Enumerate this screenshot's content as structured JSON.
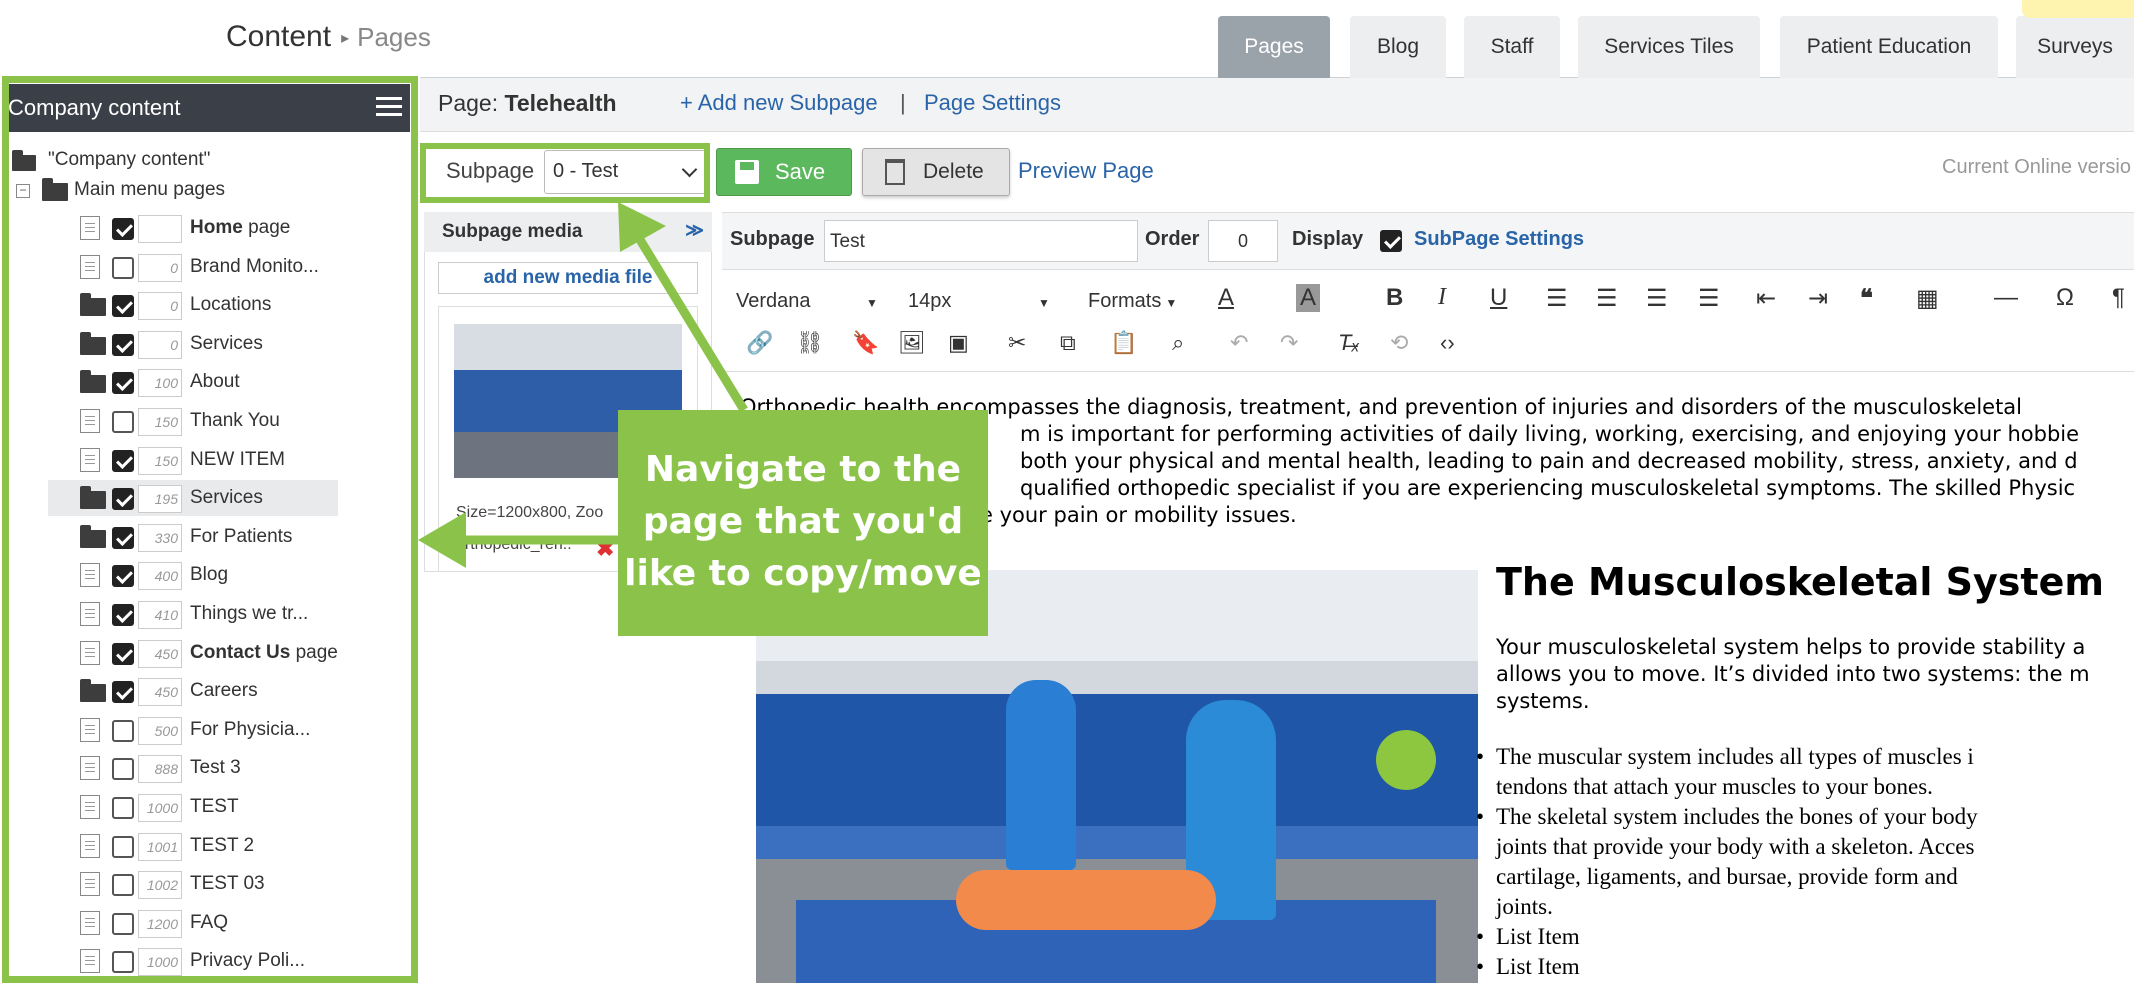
{
  "header": {
    "breadcrumb_main": "Content",
    "breadcrumb_sep": "▸",
    "breadcrumb_sub": "Pages",
    "tabs": [
      {
        "label": "Pages",
        "active": true
      },
      {
        "label": "Blog",
        "active": false
      },
      {
        "label": "Staff",
        "active": false
      },
      {
        "label": "Services Tiles",
        "active": false
      },
      {
        "label": "Patient Education",
        "active": false
      },
      {
        "label": "Surveys",
        "active": false
      }
    ]
  },
  "sidebar": {
    "title": "Company content",
    "root_label": "\"Company content\"",
    "group_label": "Main menu pages",
    "items": [
      {
        "order": "",
        "bold": "Home",
        "label": " page",
        "checked": true,
        "icon": "doc"
      },
      {
        "order": "0",
        "bold": "",
        "label": "Brand Monito...",
        "checked": false,
        "icon": "doc"
      },
      {
        "order": "0",
        "bold": "",
        "label": "Locations",
        "checked": true,
        "icon": "folder"
      },
      {
        "order": "0",
        "bold": "",
        "label": "Services",
        "checked": true,
        "icon": "folder"
      },
      {
        "order": "100",
        "bold": "",
        "label": "About",
        "checked": true,
        "icon": "folder"
      },
      {
        "order": "150",
        "bold": "",
        "label": "Thank You",
        "checked": false,
        "icon": "doc"
      },
      {
        "order": "150",
        "bold": "",
        "label": "NEW ITEM",
        "checked": true,
        "icon": "doc"
      },
      {
        "order": "195",
        "bold": "",
        "label": "Services",
        "checked": true,
        "icon": "folder",
        "selected": true
      },
      {
        "order": "330",
        "bold": "",
        "label": "For Patients",
        "checked": true,
        "icon": "folder"
      },
      {
        "order": "400",
        "bold": "",
        "label": "Blog",
        "checked": true,
        "icon": "doc"
      },
      {
        "order": "410",
        "bold": "",
        "label": "Things we tr...",
        "checked": true,
        "icon": "doc"
      },
      {
        "order": "450",
        "bold": "Contact Us",
        "label": " page",
        "checked": true,
        "icon": "doc"
      },
      {
        "order": "450",
        "bold": "",
        "label": "Careers",
        "checked": true,
        "icon": "folder"
      },
      {
        "order": "500",
        "bold": "",
        "label": "For Physicia...",
        "checked": false,
        "icon": "doc"
      },
      {
        "order": "888",
        "bold": "",
        "label": "Test 3",
        "checked": false,
        "icon": "doc"
      },
      {
        "order": "1000",
        "bold": "",
        "label": "TEST",
        "checked": false,
        "icon": "doc"
      },
      {
        "order": "1001",
        "bold": "",
        "label": "TEST 2",
        "checked": false,
        "icon": "doc"
      },
      {
        "order": "1002",
        "bold": "",
        "label": "TEST 03",
        "checked": false,
        "icon": "doc"
      },
      {
        "order": "1200",
        "bold": "",
        "label": "FAQ",
        "checked": false,
        "icon": "doc"
      },
      {
        "order": "1000",
        "bold": "",
        "label": "Privacy Poli...",
        "checked": false,
        "icon": "doc"
      }
    ]
  },
  "page": {
    "title_prefix": "Page: ",
    "title_name": "Telehealth",
    "add_subpage": "+ Add new Subpage",
    "divider": "|",
    "settings": "Page Settings"
  },
  "toolbar": {
    "subpage_label": "Subpage",
    "subpage_value": "0 - Test",
    "save_label": "Save",
    "delete_label": "Delete",
    "preview_label": "Preview Page",
    "online_version": "Current Online versio"
  },
  "media": {
    "title": "Subpage media",
    "add_label": "add new media file",
    "size_text": "Size=1200x800, Zoo",
    "file_text": "orthopedic_reh..",
    "delete_glyph": "✖"
  },
  "editor": {
    "subpage_label": "Subpage",
    "subpage_value": "Test",
    "order_label": "Order",
    "order_value": "0",
    "display_label": "Display",
    "subpage_settings": "SubPage Settings",
    "font": "Verdana",
    "size": "14px",
    "formats": "Formats"
  },
  "content": {
    "para_lines": [
      "Orthopedic health encompasses the diagnosis, treatment, and prevention of injuries and disorders of the musculoskeletal",
      "m is important for performing activities of daily living, working, exercising, and enjoying your hobbie",
      "both your physical and mental health, leading to pain and decreased mobility, stress, anxiety, and d",
      "qualified orthopedic specialist if you are experiencing musculoskeletal symptoms. The skilled Physic",
      "e your pain or mobility issues."
    ],
    "heading": "The Musculoskeletal System",
    "right_lines": [
      "Your musculoskeletal system helps to provide stability a",
      "allows you to move. It’s divided into two systems: the m",
      "systems."
    ],
    "list": [
      "The muscular system includes all types of muscles i|tendons that attach your muscles to your bones.",
      "The skeletal system includes the bones of your body|joints that provide your body with a skeleton. Acces|cartilage, ligaments, and bursae, provide form and|joints.",
      "List Item",
      "List Item"
    ]
  },
  "callout": {
    "lines": [
      "Navigate to the",
      "page that you'd",
      "like to copy/move"
    ],
    "color": "#8bc34a"
  }
}
